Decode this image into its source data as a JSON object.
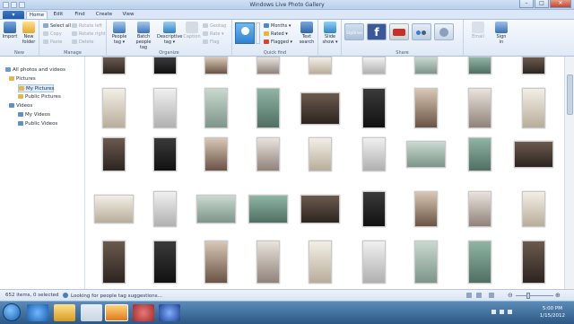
{
  "window": {
    "title": "Windows Live Photo Gallery"
  },
  "tabs": {
    "file": "",
    "home": "Home",
    "edit": "Edit",
    "find": "Find",
    "create": "Create",
    "view": "View"
  },
  "ribbon": {
    "new": {
      "import": "Import",
      "new_folder_1": "New",
      "new_folder_2": "folder",
      "label": "New"
    },
    "manage": {
      "select_all": "Select all",
      "copy": "Copy",
      "paste": "Paste",
      "rotate_left": "Rotate left",
      "rotate_right": "Rotate right",
      "delete": "Delete",
      "label": "Manage"
    },
    "organize": {
      "people_tag_1": "People",
      "people_tag_2": "tag ▾",
      "batch_1": "Batch",
      "batch_2": "people tag",
      "descriptive_1": "Descriptive",
      "descriptive_2": "tag ▾",
      "caption": "Caption",
      "geotag": "Geotag",
      "rate": "Rate ▾",
      "flag": "Flag",
      "label": "Organize"
    },
    "quickfind": {
      "months": "Months ▾",
      "rated": "Rated ▾",
      "flagged": "Flagged ▾",
      "text_search_1": "Text",
      "text_search_2": "search",
      "label": "Quick find"
    },
    "slideshow": {
      "line1": "Slide",
      "line2": "show ▾"
    },
    "share": {
      "skydrive": "SkyDrive",
      "label": "Share"
    },
    "email": "Email",
    "signin": {
      "line1": "Sign",
      "line2": "in"
    }
  },
  "sidebar": {
    "all": "All photos and videos",
    "pictures": "Pictures",
    "my_pictures": "My Pictures",
    "public_pictures": "Public Pictures",
    "videos": "Videos",
    "my_videos": "My Videos",
    "public_videos": "Public Videos"
  },
  "status": {
    "count": "652 items, 0 selected",
    "message": "Looking for people tag suggestions..."
  },
  "clock": {
    "time": "5:00 PM",
    "date": "1/15/2012"
  }
}
